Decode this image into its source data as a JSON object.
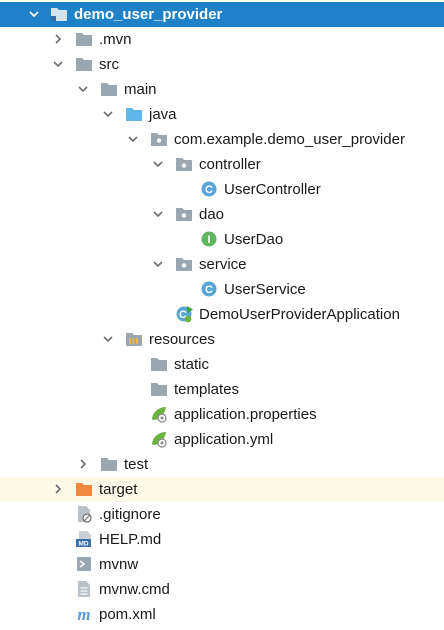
{
  "project": {
    "name": "demo_user_provider"
  },
  "nodes": {
    "mvn": ".mvn",
    "src": "src",
    "main": "main",
    "java": "java",
    "package": "com.example.demo_user_provider",
    "controller": "controller",
    "user_controller": "UserController",
    "dao": "dao",
    "user_dao": "UserDao",
    "service": "service",
    "user_service": "UserService",
    "app_class": "DemoUserProviderApplication",
    "resources": "resources",
    "static": "static",
    "templates": "templates",
    "app_properties": "application.properties",
    "app_yml": "application.yml",
    "test": "test",
    "target": "target",
    "gitignore": ".gitignore",
    "help_md": "HELP.md",
    "mvnw": "mvnw",
    "mvnw_cmd": "mvnw.cmd",
    "pom": "pom.xml"
  },
  "icons": {
    "class_badge": "C",
    "interface_badge": "I",
    "md_badge": "MD",
    "maven_badge": "m"
  },
  "colors": {
    "selection": "#1f82c9",
    "highlight_row": "#fdfbe8",
    "folder_gray": "#9aa7b0",
    "java_folder_blue": "#5fb7e8",
    "excluded_folder_orange": "#f0883e",
    "class_icon": "#5aa5d8",
    "interface_icon": "#5eb65e",
    "spring_green": "#6db33f",
    "maven_blue": "#5f9bd8"
  }
}
